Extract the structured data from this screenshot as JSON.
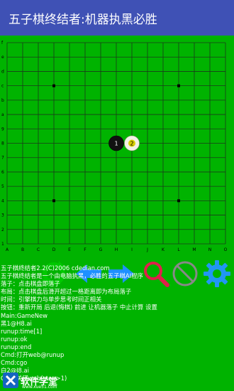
{
  "app": {
    "title": "五子棋终结者:机器执黑必胜"
  },
  "board": {
    "size": 15,
    "col_labels": [
      "A",
      "B",
      "C",
      "D",
      "E",
      "F",
      "G",
      "H",
      "I",
      "J",
      "K",
      "L",
      "M",
      "N",
      "O"
    ],
    "row_labels": [
      "1",
      "2",
      "3",
      "4",
      "5",
      "6",
      "7",
      "8",
      "9",
      "a",
      "b",
      "c",
      "d",
      "e",
      "f"
    ],
    "star_points": [
      "D4",
      "L4",
      "D12",
      "L12"
    ],
    "stones": [
      {
        "pos": "H8",
        "color": "black",
        "label": "1"
      },
      {
        "pos": "I8",
        "color": "white",
        "label": "2"
      }
    ],
    "colors": {
      "background": "#00b300",
      "grid": "#1a3a1a",
      "black_stone": "#111111",
      "white_stone": "#f2f2e6"
    }
  },
  "toolbar": {
    "items": [
      {
        "name": "restart-icon",
        "color": "#00c800"
      },
      {
        "name": "undo-arrow-icon",
        "color": "#1e90ff"
      },
      {
        "name": "redo-arrow-icon",
        "color": "#1e90ff"
      },
      {
        "name": "search-icon",
        "color": "#e0204a"
      },
      {
        "name": "prohibited-icon",
        "color": "#888888"
      },
      {
        "name": "settings-gear-icon",
        "color": "#2196f3"
      }
    ]
  },
  "log": {
    "lines": [
      "五子棋终结者2.2(C)2006 cdedian.com",
      "五子棋终结者是一个由电脑执黑，必胜的五子棋AI程序",
      "落子：点击棋盘即落子",
      "布局：点击棋盘后滑开超过一格距离即为布局落子",
      "时间：引擎棋力与单步思考时间正相关",
      "按钮：重新开局 后退(悔棋) 前进 让机器落子 中止计算 设置",
      "Main:GameNew",
      "黑1@H8.ai",
      "runup:time[1]",
      "runup:ok",
      "runup:end",
      "Cmd:打开web@runup",
      "Cmd:cgo",
      "白2@I8.ai",
      "Cmd:关闭web(step>1)"
    ]
  },
  "watermark": {
    "text": "软件学堂",
    "subtext": "www.xue51.com"
  }
}
